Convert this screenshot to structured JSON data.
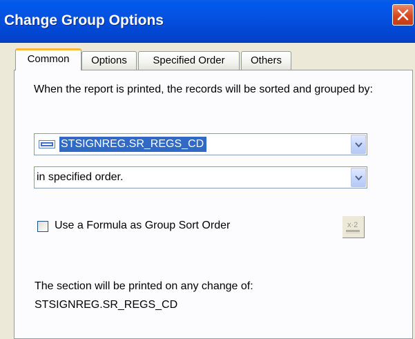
{
  "window": {
    "title": "Change Group Options",
    "close_icon": "close-icon"
  },
  "tabs": [
    {
      "label": "Common",
      "active": true
    },
    {
      "label": "Options",
      "active": false
    },
    {
      "label": "Specified Order",
      "active": false
    },
    {
      "label": "Others",
      "active": false
    }
  ],
  "common": {
    "description": "When the report is printed, the records will be sorted and grouped by:",
    "group_field": {
      "value": "STSIGNREG.SR_REGS_CD",
      "icon": "database-field-icon"
    },
    "sort_order": {
      "value": "in specified order."
    },
    "formula_checkbox": {
      "label": "Use a Formula as Group Sort Order",
      "checked": false
    },
    "formula_button_icon": "formula-editor-icon",
    "section_info": {
      "label": "The section will be printed on any change of:",
      "field": "STSIGNREG.SR_REGS_CD"
    }
  },
  "colors": {
    "titlebar": "#0553e2",
    "close_button": "#d8461f",
    "selection": "#316ac5",
    "active_tab_highlight": "#f5b83c"
  }
}
